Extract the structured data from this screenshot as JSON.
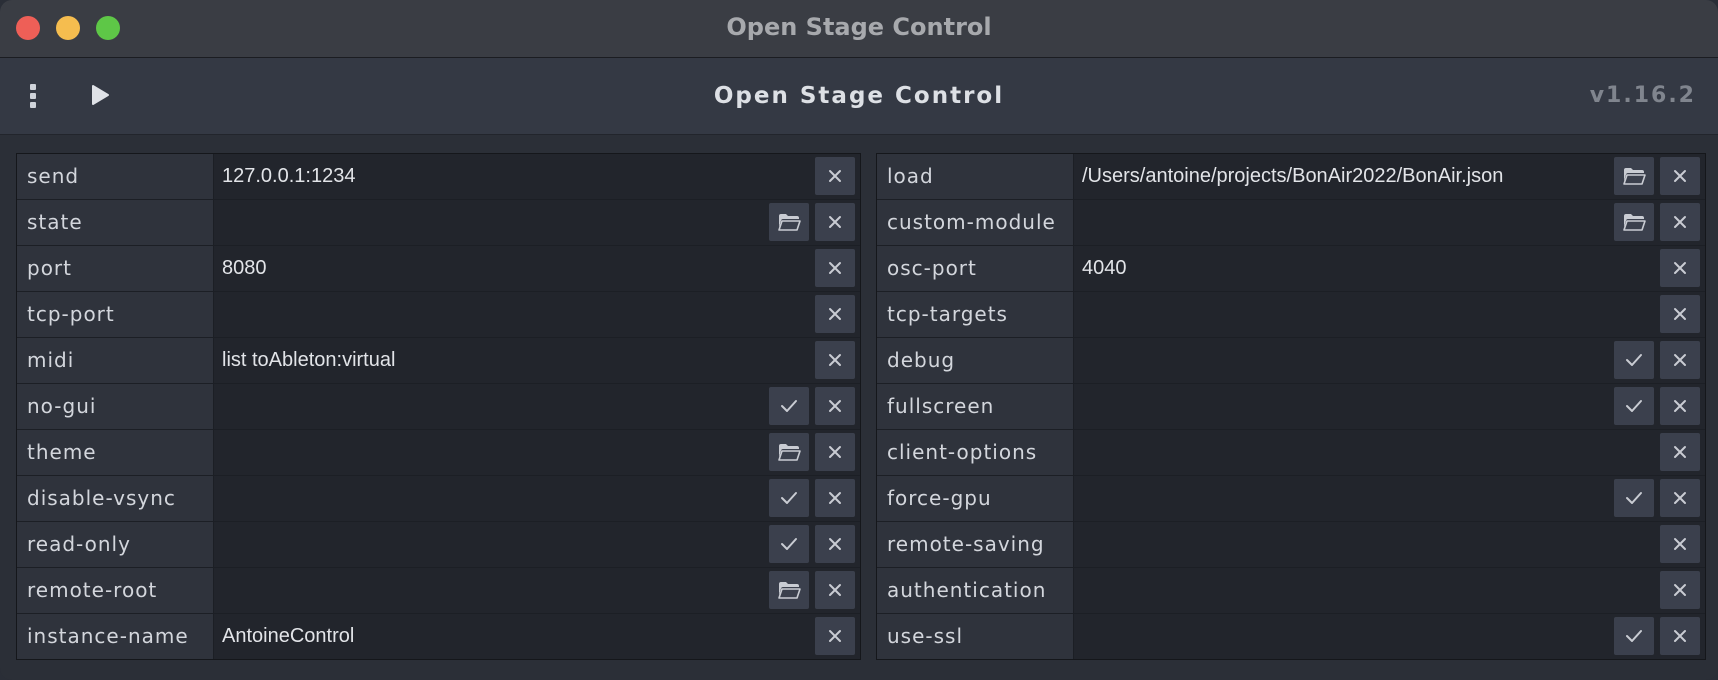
{
  "window": {
    "title": "Open Stage Control"
  },
  "toolbar": {
    "title": "Open Stage Control",
    "version": "v1.16.2",
    "menu_icon": "vertical-dots-icon",
    "play_icon": "play-icon"
  },
  "colors": {
    "accent_text": "#dde0e5",
    "label_bg": "#2f333c",
    "value_bg": "#22252c",
    "button_bg": "#3b404d"
  },
  "left_options": [
    {
      "name": "send",
      "value": "127.0.0.1:1234",
      "buttons": [
        "clear"
      ]
    },
    {
      "name": "state",
      "value": "",
      "buttons": [
        "browse",
        "clear"
      ]
    },
    {
      "name": "port",
      "value": "8080",
      "buttons": [
        "clear"
      ]
    },
    {
      "name": "tcp-port",
      "value": "",
      "buttons": [
        "clear"
      ]
    },
    {
      "name": "midi",
      "value": "list toAbleton:virtual",
      "buttons": [
        "clear"
      ]
    },
    {
      "name": "no-gui",
      "value": "",
      "buttons": [
        "check",
        "clear"
      ]
    },
    {
      "name": "theme",
      "value": "",
      "buttons": [
        "browse",
        "clear"
      ]
    },
    {
      "name": "disable-vsync",
      "value": "",
      "buttons": [
        "check",
        "clear"
      ]
    },
    {
      "name": "read-only",
      "value": "",
      "buttons": [
        "check",
        "clear"
      ]
    },
    {
      "name": "remote-root",
      "value": "",
      "buttons": [
        "browse",
        "clear"
      ]
    },
    {
      "name": "instance-name",
      "value": "AntoineControl",
      "buttons": [
        "clear"
      ]
    }
  ],
  "right_options": [
    {
      "name": "load",
      "value": "/Users/antoine/projects/BonAir2022/BonAir.json",
      "buttons": [
        "browse",
        "clear"
      ]
    },
    {
      "name": "custom-module",
      "value": "",
      "buttons": [
        "browse",
        "clear"
      ]
    },
    {
      "name": "osc-port",
      "value": "4040",
      "buttons": [
        "clear"
      ]
    },
    {
      "name": "tcp-targets",
      "value": "",
      "buttons": [
        "clear"
      ]
    },
    {
      "name": "debug",
      "value": "",
      "buttons": [
        "check",
        "clear"
      ]
    },
    {
      "name": "fullscreen",
      "value": "",
      "buttons": [
        "check",
        "clear"
      ]
    },
    {
      "name": "client-options",
      "value": "",
      "buttons": [
        "clear"
      ]
    },
    {
      "name": "force-gpu",
      "value": "",
      "buttons": [
        "check",
        "clear"
      ]
    },
    {
      "name": "remote-saving",
      "value": "",
      "buttons": [
        "clear"
      ]
    },
    {
      "name": "authentication",
      "value": "",
      "buttons": [
        "clear"
      ]
    },
    {
      "name": "use-ssl",
      "value": "",
      "buttons": [
        "check",
        "clear"
      ]
    }
  ]
}
